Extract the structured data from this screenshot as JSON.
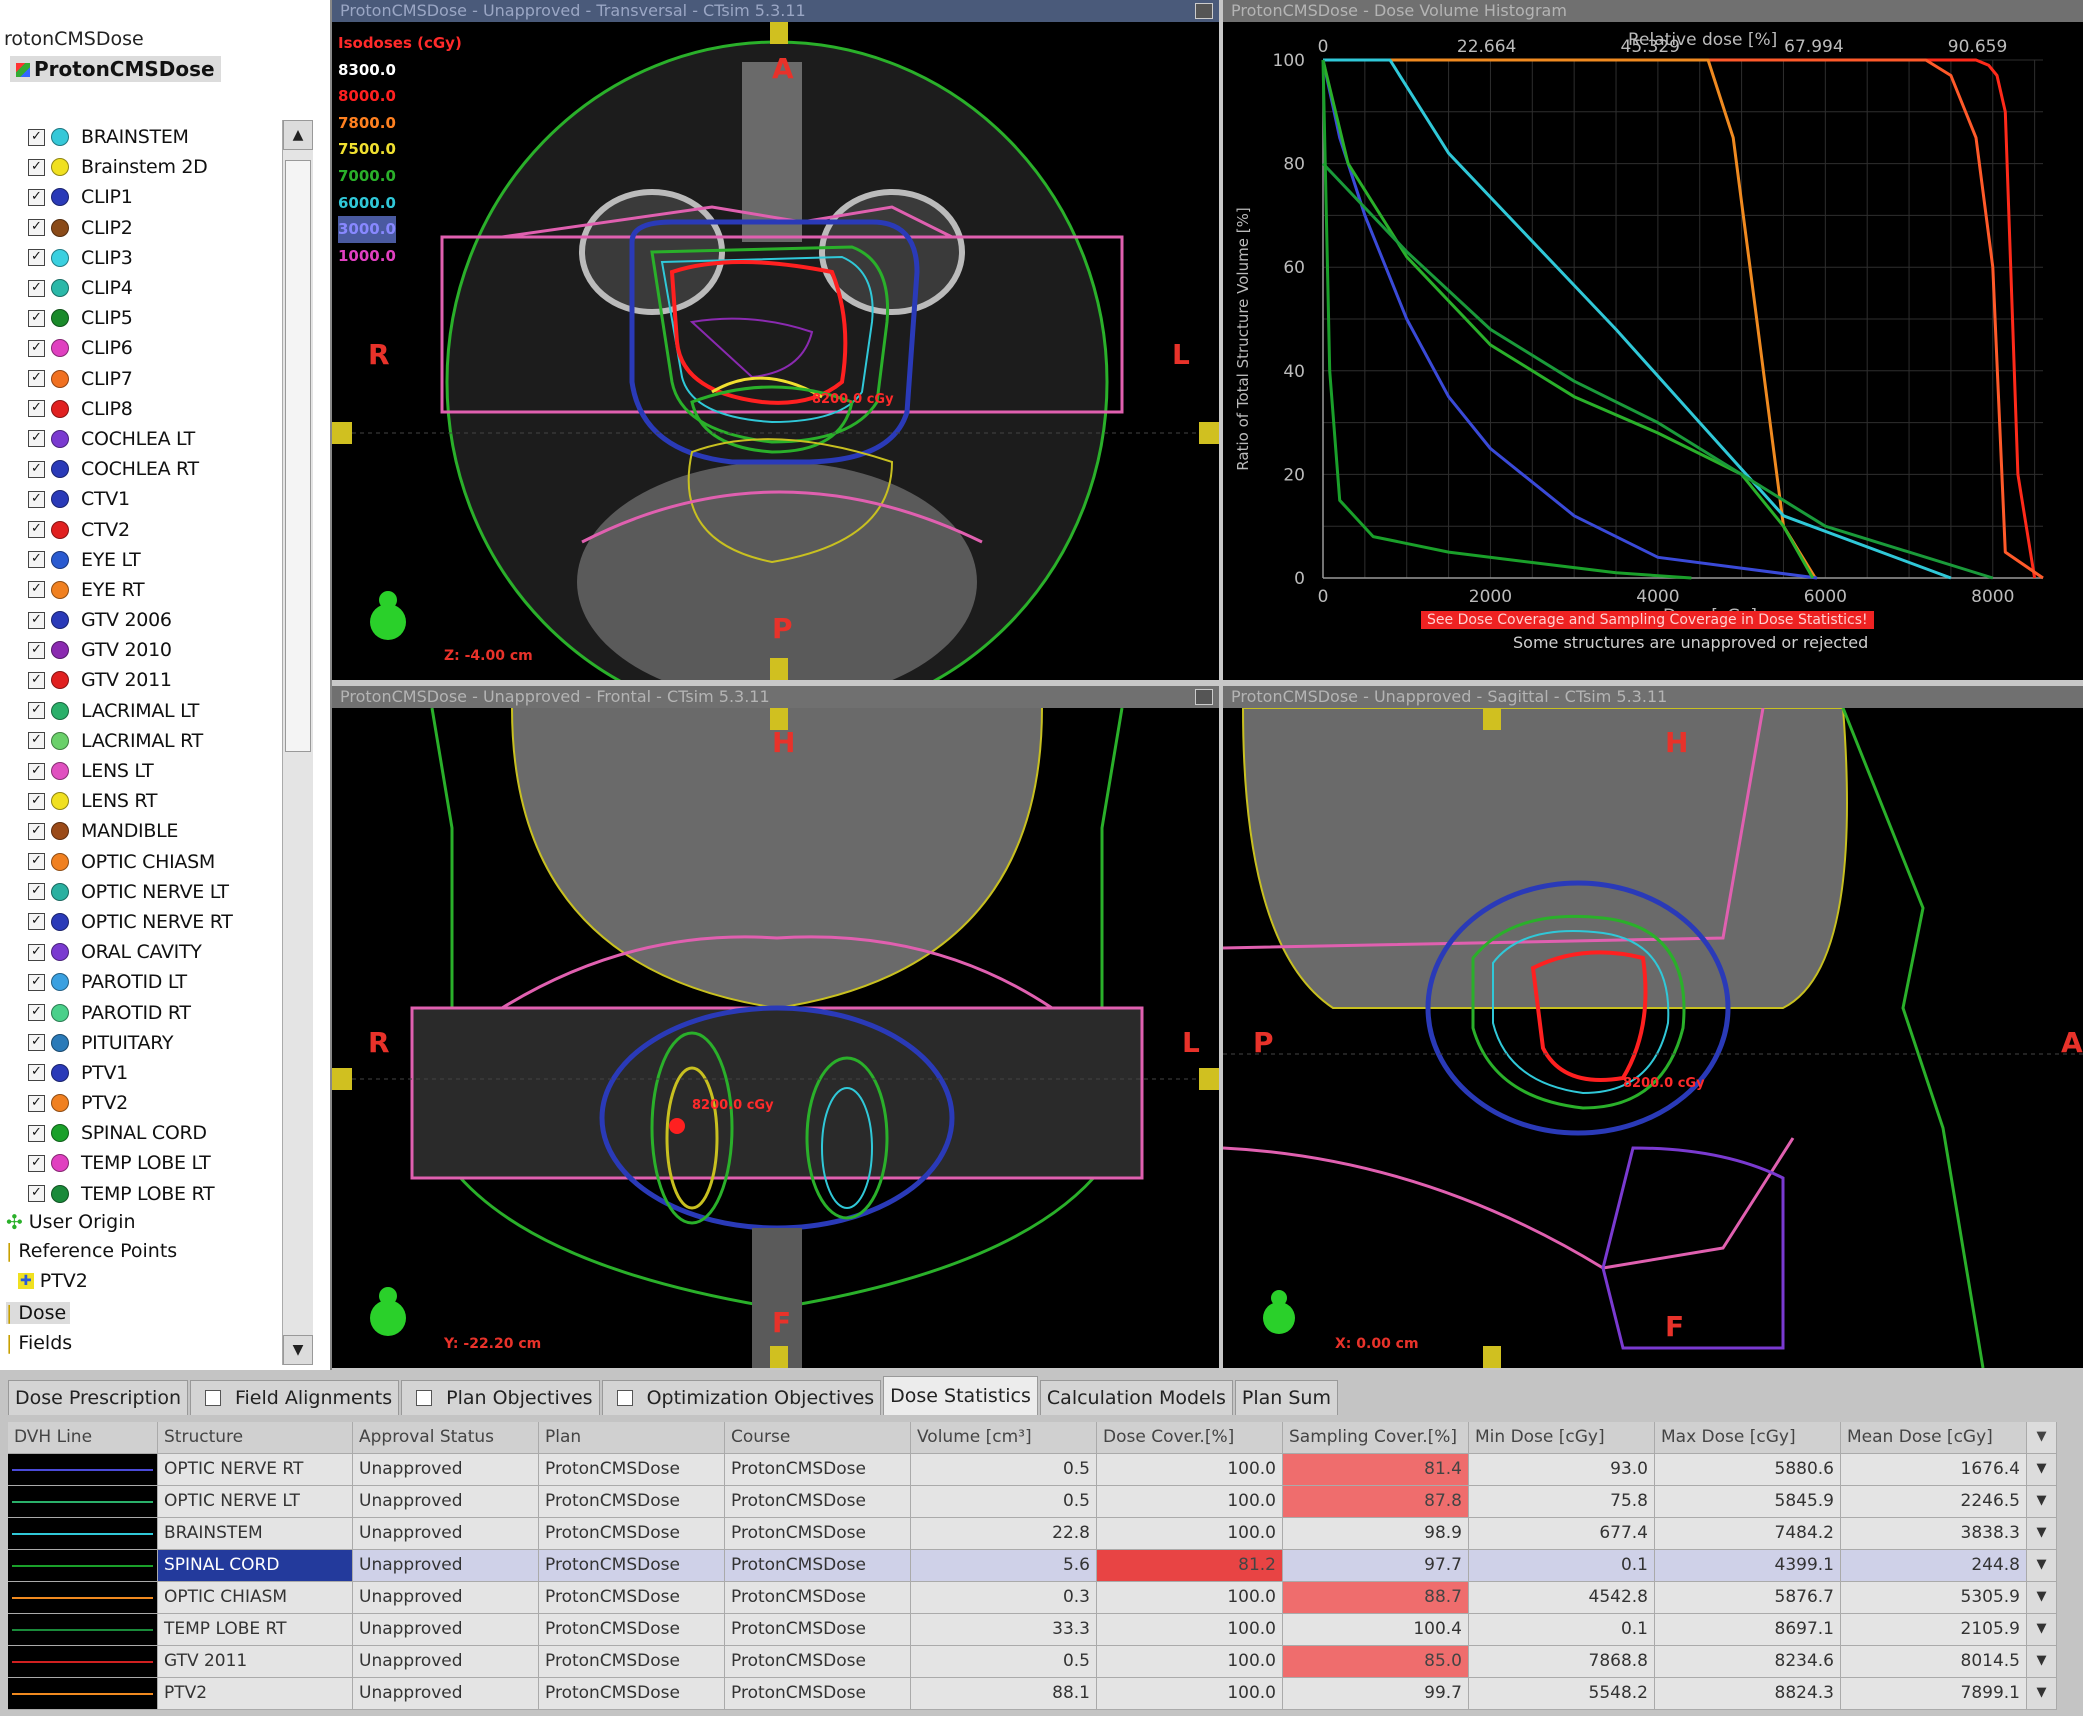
{
  "tree": {
    "header": "rotonCMSDose",
    "root": "ProtonCMSDose",
    "structures": [
      {
        "label": "BRAINSTEM",
        "color": "#35c8d8"
      },
      {
        "label": "Brainstem 2D",
        "color": "#f0e020"
      },
      {
        "label": "CLIP1",
        "color": "#2a3ab8"
      },
      {
        "label": "CLIP2",
        "color": "#8a4a18"
      },
      {
        "label": "CLIP3",
        "color": "#3ad0e0"
      },
      {
        "label": "CLIP4",
        "color": "#2ab8a8"
      },
      {
        "label": "CLIP5",
        "color": "#1a8a2a"
      },
      {
        "label": "CLIP6",
        "color": "#e040c0"
      },
      {
        "label": "CLIP7",
        "color": "#f07020"
      },
      {
        "label": "CLIP8",
        "color": "#e02020"
      },
      {
        "label": "COCHLEA LT",
        "color": "#7a3ad0"
      },
      {
        "label": "COCHLEA RT",
        "color": "#2a3ab8"
      },
      {
        "label": "CTV1",
        "color": "#2a3ab8"
      },
      {
        "label": "CTV2",
        "color": "#e02020"
      },
      {
        "label": "EYE LT",
        "color": "#2a5ad0"
      },
      {
        "label": "EYE RT",
        "color": "#f08020"
      },
      {
        "label": "GTV 2006",
        "color": "#2a3ab8"
      },
      {
        "label": "GTV 2010",
        "color": "#8a2ab0"
      },
      {
        "label": "GTV 2011",
        "color": "#e02020"
      },
      {
        "label": "LACRIMAL LT",
        "color": "#2ab06a"
      },
      {
        "label": "LACRIMAL RT",
        "color": "#6ad06a"
      },
      {
        "label": "LENS LT",
        "color": "#e050c0"
      },
      {
        "label": "LENS RT",
        "color": "#f0e020"
      },
      {
        "label": "MANDIBLE",
        "color": "#9a4a18"
      },
      {
        "label": "OPTIC CHIASM",
        "color": "#f08020"
      },
      {
        "label": "OPTIC NERVE LT",
        "color": "#2ab0a0"
      },
      {
        "label": "OPTIC NERVE RT",
        "color": "#2a3ab8"
      },
      {
        "label": "ORAL CAVITY",
        "color": "#7a3ad0"
      },
      {
        "label": "PAROTID LT",
        "color": "#3aa0e0"
      },
      {
        "label": "PAROTID RT",
        "color": "#4ad08a"
      },
      {
        "label": "PITUITARY",
        "color": "#2a7ab8"
      },
      {
        "label": "PTV1",
        "color": "#2a3ab8"
      },
      {
        "label": "PTV2",
        "color": "#f08020"
      },
      {
        "label": "SPINAL CORD",
        "color": "#1aa02a"
      },
      {
        "label": "TEMP LOBE LT",
        "color": "#e040c0"
      },
      {
        "label": "TEMP LOBE RT",
        "color": "#1a8a3a"
      }
    ],
    "user_origin": "User Origin",
    "reference_points": "Reference Points",
    "ref_ptv2": "PTV2",
    "dose": "Dose",
    "fields": "Fields"
  },
  "views": {
    "transversal": {
      "title": "ProtonCMSDose - Unapproved - Transversal - CTsim 5.3.11",
      "orient_top": "A",
      "orient_bottom": "P",
      "orient_left": "R",
      "orient_right": "L",
      "coord": "Z: -4.00 cm",
      "dose_label": "8200.0 cGy"
    },
    "frontal": {
      "title": "ProtonCMSDose - Unapproved - Frontal - CTsim 5.3.11",
      "orient_top": "H",
      "orient_bottom": "F",
      "orient_left": "R",
      "orient_right": "L",
      "coord": "Y: -22.20 cm",
      "dose_label": "8200.0 cGy"
    },
    "sagittal": {
      "title": "ProtonCMSDose - Unapproved - Sagittal - CTsim 5.3.11",
      "orient_top": "H",
      "orient_bottom": "F",
      "orient_left": "P",
      "orient_right": "A",
      "coord": "X: 0.00 cm",
      "dose_label": "8200.0 cGy"
    }
  },
  "isodoses": {
    "title": "Isodoses (cGy)",
    "levels": [
      {
        "label": "8300.0",
        "color": "#ffffff"
      },
      {
        "label": "8000.0",
        "color": "#ff2020"
      },
      {
        "label": "7800.0",
        "color": "#ff8020"
      },
      {
        "label": "7500.0",
        "color": "#f0e030"
      },
      {
        "label": "7000.0",
        "color": "#2ab02a"
      },
      {
        "label": "6000.0",
        "color": "#30c8d8"
      },
      {
        "label": "3000.0",
        "color": "#8888ff"
      },
      {
        "label": "1000.0",
        "color": "#e040c0"
      }
    ]
  },
  "dvh": {
    "title": "ProtonCMSDose - Dose Volume Histogram",
    "top_axis_label": "Relative dose [%]",
    "top_ticks": [
      "0",
      "22.664",
      "45.329",
      "67.994",
      "90.659"
    ],
    "ylabel": "Ratio of Total Structure Volume [%]",
    "xlabel": "Dose [cGy]",
    "x_ticks": [
      "0",
      "2000",
      "4000",
      "6000",
      "8000"
    ],
    "y_ticks": [
      "100",
      "80",
      "60",
      "40",
      "20",
      "0"
    ],
    "banner": "See Dose Coverage and Sampling Coverage in Dose Statistics!",
    "note": "Some structures are unapproved or rejected"
  },
  "chart_data": {
    "type": "line",
    "xlabel": "Dose [cGy]",
    "ylabel": "Ratio of Total Structure Volume [%]",
    "xlim": [
      0,
      8600
    ],
    "ylim": [
      0,
      100
    ],
    "grid": true,
    "series": [
      {
        "color": "#ff2a1a",
        "x": [
          0,
          7800,
          7950,
          8050,
          8150,
          8300,
          8500
        ],
        "y": [
          100,
          100,
          99,
          97,
          90,
          20,
          0
        ]
      },
      {
        "color": "#ff5a2a",
        "x": [
          0,
          7200,
          7500,
          7800,
          8000,
          8150,
          8600
        ],
        "y": [
          100,
          100,
          97,
          85,
          60,
          5,
          0
        ]
      },
      {
        "color": "#f08a20",
        "x": [
          0,
          4600,
          4900,
          5100,
          5300,
          5500,
          5880
        ],
        "y": [
          100,
          100,
          85,
          60,
          35,
          10,
          0
        ]
      },
      {
        "color": "#30c8d8",
        "x": [
          0,
          800,
          1500,
          2500,
          3500,
          4500,
          5500,
          7500
        ],
        "y": [
          100,
          100,
          82,
          65,
          48,
          30,
          12,
          0
        ]
      },
      {
        "color": "#3a4ad8",
        "x": [
          0,
          200,
          500,
          1000,
          1500,
          2000,
          3000,
          4000,
          5900
        ],
        "y": [
          100,
          85,
          70,
          50,
          35,
          25,
          12,
          4,
          0
        ]
      },
      {
        "color": "#2ab02a",
        "x": [
          0,
          300,
          1000,
          2000,
          3000,
          4000,
          5000,
          5500,
          5850
        ],
        "y": [
          100,
          80,
          62,
          45,
          35,
          28,
          20,
          10,
          0
        ]
      },
      {
        "color": "#1a9a3a",
        "x": [
          0,
          1000,
          2000,
          3000,
          4000,
          5000,
          6000,
          8000
        ],
        "y": [
          80,
          63,
          48,
          38,
          30,
          20,
          10,
          0
        ]
      },
      {
        "color": "#1aa02a",
        "x": [
          0,
          80,
          200,
          600,
          1500,
          2500,
          3500,
          4400
        ],
        "y": [
          100,
          40,
          15,
          8,
          5,
          3,
          1,
          0
        ]
      }
    ]
  },
  "tabs": [
    {
      "label": "Dose Prescription",
      "checkbox": false,
      "active": false
    },
    {
      "label": "Field Alignments",
      "checkbox": true,
      "active": false
    },
    {
      "label": "Plan Objectives",
      "checkbox": true,
      "active": false
    },
    {
      "label": "Optimization Objectives",
      "checkbox": true,
      "active": false
    },
    {
      "label": "Dose Statistics",
      "checkbox": false,
      "active": true
    },
    {
      "label": "Calculation Models",
      "checkbox": false,
      "active": false
    },
    {
      "label": "Plan Sum",
      "checkbox": false,
      "active": false
    }
  ],
  "table": {
    "headers": [
      "DVH Line",
      "Structure",
      "Approval Status",
      "Plan",
      "Course",
      "Volume [cm³]",
      "Dose Cover.[%]",
      "Sampling Cover.[%]",
      "Min Dose [cGy]",
      "Max Dose [cGy]",
      "Mean Dose [cGy]"
    ],
    "rows": [
      {
        "line": "#4a4ad8",
        "structure": "OPTIC NERVE RT",
        "status": "Unapproved",
        "plan": "ProtonCMSDose",
        "course": "ProtonCMSDose",
        "volume": "0.5",
        "dose_cover": "100.0",
        "sampling": "81.4",
        "min": "93.0",
        "max": "5880.6",
        "mean": "1676.4",
        "alert_sampling": true
      },
      {
        "line": "#2ab06a",
        "structure": "OPTIC NERVE LT",
        "status": "Unapproved",
        "plan": "ProtonCMSDose",
        "course": "ProtonCMSDose",
        "volume": "0.5",
        "dose_cover": "100.0",
        "sampling": "87.8",
        "min": "75.8",
        "max": "5845.9",
        "mean": "2246.5",
        "alert_sampling": true
      },
      {
        "line": "#30c8d8",
        "structure": "BRAINSTEM",
        "status": "Unapproved",
        "plan": "ProtonCMSDose",
        "course": "ProtonCMSDose",
        "volume": "22.8",
        "dose_cover": "100.0",
        "sampling": "98.9",
        "min": "677.4",
        "max": "7484.2",
        "mean": "3838.3"
      },
      {
        "line": "#1aa02a",
        "structure": "SPINAL CORD",
        "status": "Unapproved",
        "plan": "ProtonCMSDose",
        "course": "ProtonCMSDose",
        "volume": "5.6",
        "dose_cover": "81.2",
        "sampling": "97.7",
        "min": "0.1",
        "max": "4399.1",
        "mean": "244.8",
        "alert_dose": true,
        "selected": true
      },
      {
        "line": "#f08a20",
        "structure": "OPTIC CHIASM",
        "status": "Unapproved",
        "plan": "ProtonCMSDose",
        "course": "ProtonCMSDose",
        "volume": "0.3",
        "dose_cover": "100.0",
        "sampling": "88.7",
        "min": "4542.8",
        "max": "5876.7",
        "mean": "5305.9",
        "alert_sampling": true
      },
      {
        "line": "#1a8a3a",
        "structure": "TEMP LOBE RT",
        "status": "Unapproved",
        "plan": "ProtonCMSDose",
        "course": "ProtonCMSDose",
        "volume": "33.3",
        "dose_cover": "100.0",
        "sampling": "100.4",
        "min": "0.1",
        "max": "8697.1",
        "mean": "2105.9"
      },
      {
        "line": "#d02020",
        "structure": "GTV 2011",
        "status": "Unapproved",
        "plan": "ProtonCMSDose",
        "course": "ProtonCMSDose",
        "volume": "0.5",
        "dose_cover": "100.0",
        "sampling": "85.0",
        "min": "7868.8",
        "max": "8234.6",
        "mean": "8014.5",
        "alert_sampling": true
      },
      {
        "line": "#f08a20",
        "structure": "PTV2",
        "status": "Unapproved",
        "plan": "ProtonCMSDose",
        "course": "ProtonCMSDose",
        "volume": "88.1",
        "dose_cover": "100.0",
        "sampling": "99.7",
        "min": "5548.2",
        "max": "8824.3",
        "mean": "7899.1"
      }
    ]
  }
}
